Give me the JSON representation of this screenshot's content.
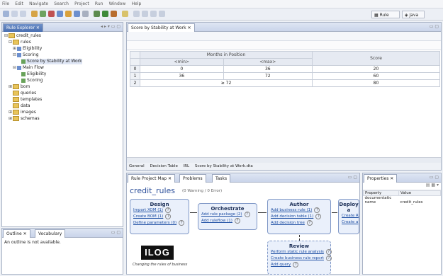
{
  "menubar": {
    "items": [
      "File",
      "Edit",
      "Navigate",
      "Search",
      "Project",
      "Run",
      "Window",
      "Help"
    ]
  },
  "toolbar": {
    "perspective_rule": "Rule",
    "perspective_java": "Java"
  },
  "explorer": {
    "tab": "Rule Explorer",
    "items": [
      {
        "label": "credit_rules"
      },
      {
        "label": "rules"
      },
      {
        "label": "Eligibility"
      },
      {
        "label": "Scoring"
      },
      {
        "label": "Score by Stability at Work"
      },
      {
        "label": "Main Flow"
      },
      {
        "label": "Eligibility"
      },
      {
        "label": "Scoring"
      },
      {
        "label": "bom"
      },
      {
        "label": "queries"
      },
      {
        "label": "templates"
      },
      {
        "label": "data"
      },
      {
        "label": "images"
      },
      {
        "label": "schemas"
      }
    ]
  },
  "outline": {
    "tab": "Outline",
    "tab2": "Vocabulary",
    "message": "An outline is not available."
  },
  "editor": {
    "tab": "Score by Stability at Work",
    "group_header": "Months in Position",
    "min_header": "<min>",
    "max_header": "<max>",
    "score_header": "Score",
    "rows": [
      {
        "n": "0",
        "min": "0",
        "max": "36",
        "score": "20"
      },
      {
        "n": "1",
        "min": "36",
        "max": "72",
        "score": "60"
      },
      {
        "n": "2",
        "range": "≥ 72",
        "score": "80"
      }
    ],
    "bottom_tabs": [
      "General",
      "Decision Table",
      "IRL",
      "Score by Stability at Work.dta"
    ]
  },
  "projectmap": {
    "tab": "Rule Project Map",
    "tab2": "Problems",
    "tab3": "Tasks",
    "title": "credit_rules",
    "status": "(0 Warning / 0 Error)",
    "design": {
      "title": "Design",
      "links": [
        "Import XOM (1)",
        "Create BOM (1)",
        "Define parameters (0)"
      ]
    },
    "orchestrate": {
      "title": "Orchestrate",
      "links": [
        "Add rule package (2)",
        "Add ruleflow (1)"
      ]
    },
    "author": {
      "title": "Author",
      "links": [
        "Add business rule (1)",
        "Add decision table (1)",
        "Add decision tree"
      ]
    },
    "deploy": {
      "title": "Deploy a",
      "links": [
        "Create R",
        "Create a"
      ]
    },
    "review": {
      "title": "Review",
      "links": [
        "Perform static rule analysis",
        "Create business rule report",
        "Add query"
      ]
    },
    "logo": "ILOG",
    "tagline": "Changing the rules of business"
  },
  "properties": {
    "tab": "Properties",
    "col_property": "Property",
    "col_value": "Value",
    "rows": [
      {
        "p": "documentatic",
        "v": ""
      },
      {
        "p": "name",
        "v": "credit_rules"
      }
    ]
  }
}
